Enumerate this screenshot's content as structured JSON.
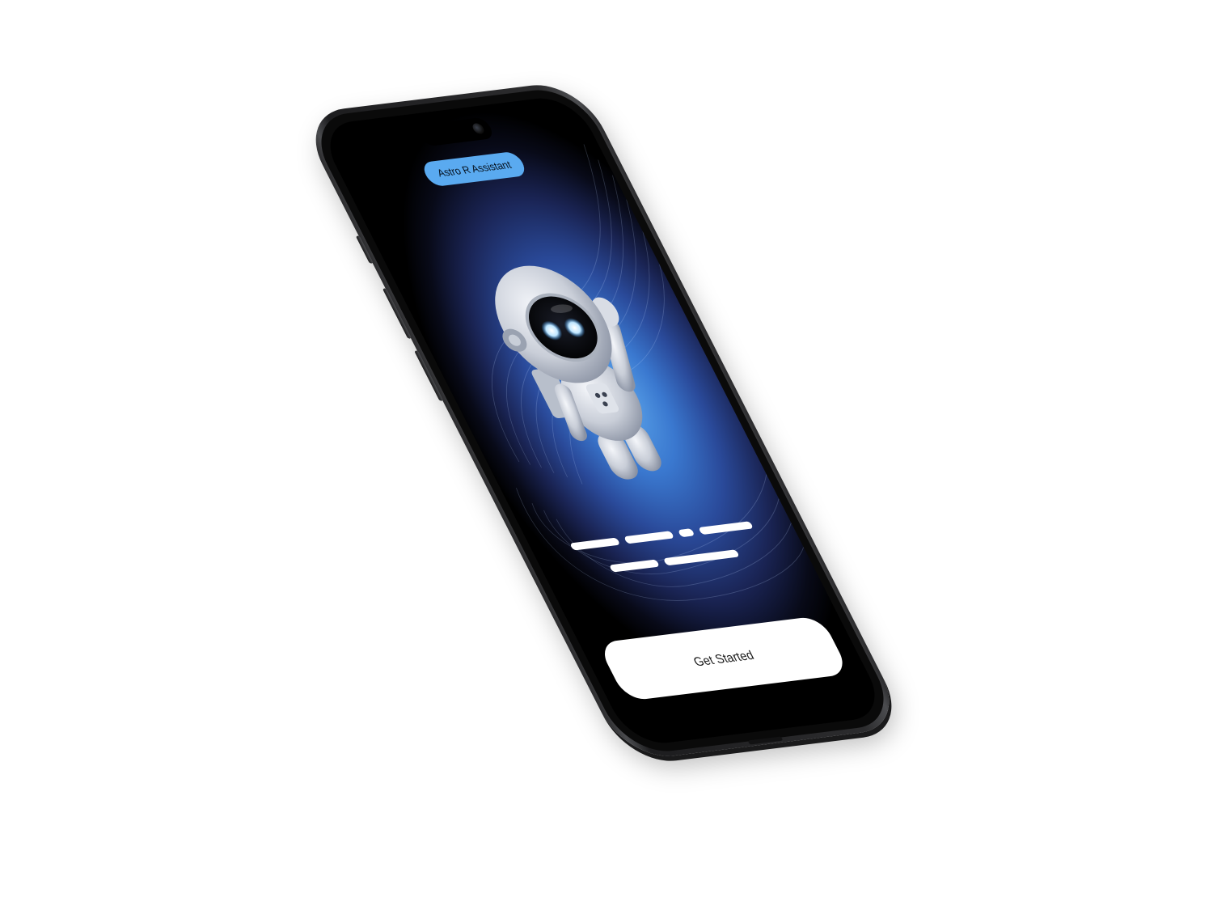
{
  "app": {
    "badge_label": "Astro R Assistant",
    "cta_label": "Get Started"
  },
  "placeholder_text": {
    "lines": [
      {
        "bars": 4
      },
      {
        "bars": 2
      }
    ]
  },
  "colors": {
    "badge": "#5aaaf0",
    "screen_glow": "#5da7ec",
    "screen_dark": "#000000",
    "cta_background": "#ffffff",
    "phone_frame": "#2c2c2e"
  },
  "icons": {
    "mascot": "astronaut-robot-icon",
    "camera": "front-camera-icon"
  }
}
